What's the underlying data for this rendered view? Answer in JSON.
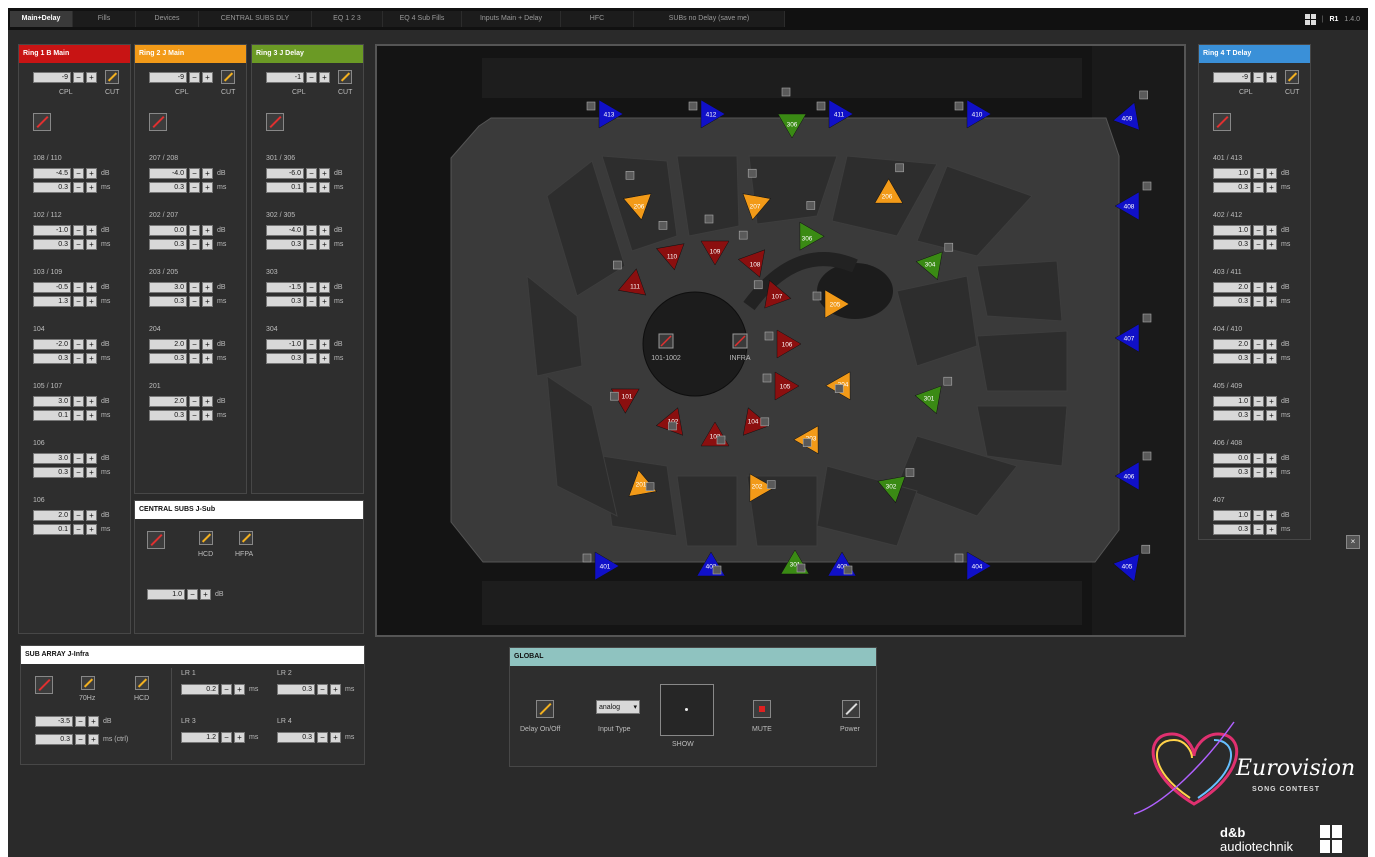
{
  "tabs": [
    "Main+Delay",
    "Fills",
    "Devices",
    "CENTRAL SUBS DLY",
    "EQ 1 2 3",
    "EQ 4 Sub Fills",
    "Inputs Main + Delay",
    "HFC",
    "SUBs no Delay (save me)"
  ],
  "topright": {
    "page": "R1",
    "version": "1.4.0"
  },
  "rings": [
    {
      "title": "Ring 1 B Main",
      "color": "#c81414",
      "cpl_value": "-9",
      "cpl_label": "CPL",
      "cut_label": "CUT",
      "groups": [
        {
          "name": "108 / 110",
          "db": "-4.5",
          "ms": "0.3"
        },
        {
          "name": "102 / 112",
          "db": "-1.0",
          "ms": "0.3"
        },
        {
          "name": "103 / 109",
          "db": "-0.5",
          "ms": "1.3"
        },
        {
          "name": "104",
          "db": "-2.0",
          "ms": "0.3"
        },
        {
          "name": "105 / 107",
          "db": "3.0",
          "ms": "0.1"
        },
        {
          "name": "106",
          "db": "3.0",
          "ms": "0.3"
        },
        {
          "name": "106",
          "db": "2.0",
          "ms": "0.1"
        }
      ]
    },
    {
      "title": "Ring 2 J Main",
      "color": "#f29a18",
      "cpl_value": "-9",
      "cpl_label": "CPL",
      "cut_label": "CUT",
      "groups": [
        {
          "name": "207 / 208",
          "db": "-4.0",
          "ms": "0.3"
        },
        {
          "name": "202 / 207",
          "db": "0.0",
          "ms": "0.3"
        },
        {
          "name": "203 / 205",
          "db": "3.0",
          "ms": "0.3"
        },
        {
          "name": "204",
          "db": "2.0",
          "ms": "0.3"
        },
        {
          "name": "201",
          "db": "2.0",
          "ms": "0.3"
        }
      ]
    },
    {
      "title": "Ring 3 J Delay",
      "color": "#6b9a25",
      "cpl_value": "-1",
      "cpl_label": "CPL",
      "cut_label": "CUT",
      "groups": [
        {
          "name": "301 / 306",
          "db": "-6.0",
          "ms": "0.1"
        },
        {
          "name": "302 / 305",
          "db": "-4.0",
          "ms": "0.3"
        },
        {
          "name": "303",
          "db": "-1.5",
          "ms": "0.3"
        },
        {
          "name": "304",
          "db": "-1.0",
          "ms": "0.3"
        }
      ]
    },
    {
      "title": "Ring 4 T Delay",
      "color": "#3a90d8",
      "cpl_value": "-9",
      "cpl_label": "CPL",
      "cut_label": "CUT",
      "groups": [
        {
          "name": "401 / 413",
          "db": "1.0",
          "ms": "0.3"
        },
        {
          "name": "402 / 412",
          "db": "1.0",
          "ms": "0.3"
        },
        {
          "name": "403 / 411",
          "db": "2.0",
          "ms": "0.3"
        },
        {
          "name": "404 / 410",
          "db": "2.0",
          "ms": "0.3"
        },
        {
          "name": "405 / 409",
          "db": "1.0",
          "ms": "0.3"
        },
        {
          "name": "406 / 408",
          "db": "0.0",
          "ms": "0.3"
        },
        {
          "name": "407",
          "db": "1.0",
          "ms": "0.3"
        }
      ]
    }
  ],
  "units": {
    "db": "dB",
    "ms": "ms"
  },
  "central_subs": {
    "title": "CENTRAL SUBS J-Sub",
    "hcd": "HCD",
    "hfpa": "HFPA",
    "value": "1.0",
    "unit": "dB"
  },
  "sub_array": {
    "title": "SUB ARRAY J-Infra",
    "hz": "70Hz",
    "hcd": "HCD",
    "gain": "-3.5",
    "gain_unit": "dB",
    "delay": "0.3",
    "delay_unit": "ms (ctrl)",
    "lr": [
      {
        "name": "LR 1",
        "value": "0.2",
        "unit": "ms"
      },
      {
        "name": "LR 2",
        "value": "0.3",
        "unit": "ms"
      },
      {
        "name": "LR 3",
        "value": "1.2",
        "unit": "ms"
      },
      {
        "name": "LR 4",
        "value": "0.3",
        "unit": "ms"
      }
    ]
  },
  "global": {
    "title": "GLOBAL",
    "delay_label": "Delay On/Off",
    "input_type_label": "Input Type",
    "input_type_value": "analog",
    "show_label": "SHOW",
    "mute_label": "MUTE",
    "power_label": "Power"
  },
  "stage": {
    "center_labels": [
      "101-1002",
      "INFRA"
    ]
  },
  "logos": {
    "esc_name": "Eurovision",
    "esc_sub": "SONG CONTEST",
    "db_brand": "d&b",
    "db_brand2": "audiotechnik"
  },
  "colors": {
    "ring1": "#8b0f0f",
    "ring2": "#f29a18",
    "ring3": "#3a8a14",
    "ring4": "#1010c8"
  },
  "speakers": [
    {
      "id": "413",
      "ring": 4
    },
    {
      "id": "412",
      "ring": 4
    },
    {
      "id": "306",
      "ring": 3
    },
    {
      "id": "411",
      "ring": 4
    },
    {
      "id": "410",
      "ring": 4
    },
    {
      "id": "409",
      "ring": 4
    },
    {
      "id": "206",
      "ring": 2
    },
    {
      "id": "207",
      "ring": 2
    },
    {
      "id": "306",
      "ring": 3
    },
    {
      "id": "408",
      "ring": 4
    },
    {
      "id": "110",
      "ring": 1
    },
    {
      "id": "109",
      "ring": 1
    },
    {
      "id": "108",
      "ring": 1
    },
    {
      "id": "206",
      "ring": 2
    },
    {
      "id": "304",
      "ring": 3
    },
    {
      "id": "111",
      "ring": 1
    },
    {
      "id": "107",
      "ring": 1
    },
    {
      "id": "205",
      "ring": 2
    },
    {
      "id": "407",
      "ring": 4
    },
    {
      "id": "106",
      "ring": 1
    },
    {
      "id": "105",
      "ring": 1
    },
    {
      "id": "204",
      "ring": 2
    },
    {
      "id": "301",
      "ring": 3
    },
    {
      "id": "101",
      "ring": 1
    },
    {
      "id": "102",
      "ring": 1
    },
    {
      "id": "103",
      "ring": 1
    },
    {
      "id": "104",
      "ring": 1
    },
    {
      "id": "203",
      "ring": 2
    },
    {
      "id": "406",
      "ring": 4
    },
    {
      "id": "201",
      "ring": 2
    },
    {
      "id": "202",
      "ring": 2
    },
    {
      "id": "302",
      "ring": 3
    },
    {
      "id": "401",
      "ring": 4
    },
    {
      "id": "402",
      "ring": 4
    },
    {
      "id": "301",
      "ring": 3
    },
    {
      "id": "403",
      "ring": 4
    },
    {
      "id": "404",
      "ring": 4
    },
    {
      "id": "405",
      "ring": 4
    }
  ]
}
